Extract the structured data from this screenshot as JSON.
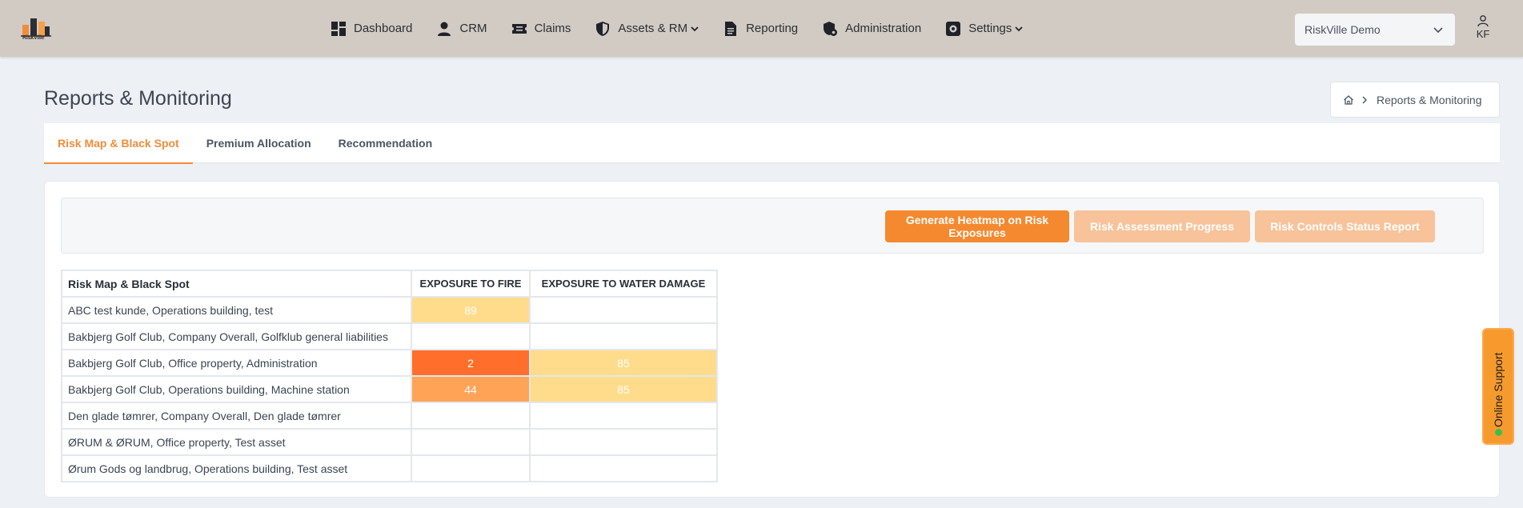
{
  "app": {
    "logo_text": "RiskVille"
  },
  "nav": {
    "items": [
      {
        "label": "Dashboard",
        "icon": "dashboard-icon"
      },
      {
        "label": "CRM",
        "icon": "person-icon"
      },
      {
        "label": "Claims",
        "icon": "ticket-icon"
      },
      {
        "label": "Assets & RM",
        "icon": "shield-icon",
        "dropdown": true
      },
      {
        "label": "Reporting",
        "icon": "document-icon"
      },
      {
        "label": "Administration",
        "icon": "shield-lock-icon"
      },
      {
        "label": "Settings",
        "icon": "gear-icon",
        "dropdown": true
      }
    ],
    "org_select": "RiskVille Demo",
    "user_initials": "KF"
  },
  "page": {
    "title": "Reports & Monitoring",
    "breadcrumb": "Reports & Monitoring"
  },
  "tabs": [
    {
      "label": "Risk Map & Black Spot",
      "active": true
    },
    {
      "label": "Premium Allocation",
      "active": false
    },
    {
      "label": "Recommendation",
      "active": false
    }
  ],
  "toolbar": {
    "buttons": [
      {
        "label": "Generate Heatmap on Risk Exposures",
        "enabled": true
      },
      {
        "label": "Risk Assessment Progress",
        "enabled": false
      },
      {
        "label": "Risk Controls Status Report",
        "enabled": false
      }
    ]
  },
  "table": {
    "header": [
      "Risk Map & Black Spot",
      "EXPOSURE TO FIRE",
      "EXPOSURE TO WATER DAMAGE"
    ],
    "rows": [
      {
        "label": "ABC test kunde, Operations building, test",
        "fire": "89",
        "fire_color": "#ffdc8b",
        "water": "",
        "water_color": "#ffffff"
      },
      {
        "label": "Bakbjerg Golf Club, Company Overall, Golfklub general liabilities",
        "fire": "",
        "fire_color": "#ffffff",
        "water": "",
        "water_color": "#ffffff"
      },
      {
        "label": "Bakbjerg Golf Club, Office property, Administration",
        "fire": "2",
        "fire_color": "#ff6f2b",
        "water": "85",
        "water_color": "#ffdc8b"
      },
      {
        "label": "Bakbjerg Golf Club, Operations building, Machine station",
        "fire": "44",
        "fire_color": "#ffa357",
        "water": "85",
        "water_color": "#ffdc8b"
      },
      {
        "label": "Den glade tømrer, Company Overall, Den glade tømrer",
        "fire": "",
        "fire_color": "#ffffff",
        "water": "",
        "water_color": "#ffffff"
      },
      {
        "label": "ØRUM & ØRUM, Office property, Test asset",
        "fire": "",
        "fire_color": "#ffffff",
        "water": "",
        "water_color": "#ffffff"
      },
      {
        "label": "Ørum Gods og landbrug, Operations building, Test asset",
        "fire": "",
        "fire_color": "#ffffff",
        "water": "",
        "water_color": "#ffffff"
      }
    ]
  },
  "support": {
    "label": "Online Support",
    "status_color": "#3bbf4b"
  },
  "colors": {
    "accent": "#f28c38",
    "topbar": "#d2cbc3",
    "background": "#edf0f4"
  }
}
